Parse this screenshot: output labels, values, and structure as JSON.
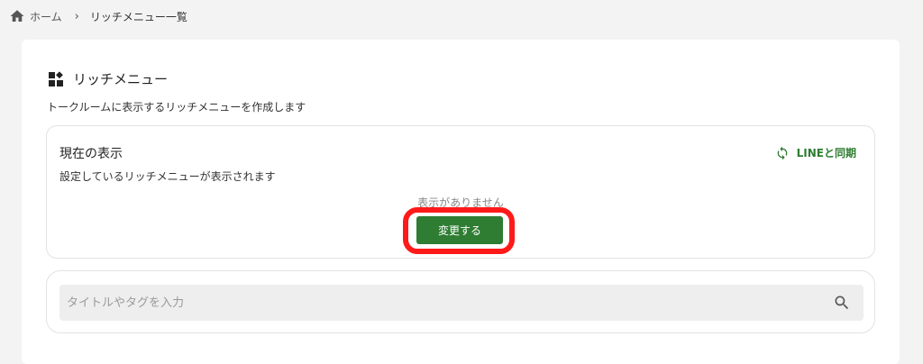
{
  "breadcrumb": {
    "home_label": "ホーム",
    "separator": "›",
    "current": "リッチメニュー一覧"
  },
  "section": {
    "title": "リッチメニュー",
    "description": "トークルームに表示するリッチメニューを作成します"
  },
  "current_display": {
    "title": "現在の表示",
    "description": "設定しているリッチメニューが表示されます",
    "sync_label": "LINEと同期",
    "empty_text": "表示がありません",
    "change_button": "変更する"
  },
  "search": {
    "placeholder": "タイトルやタグを入力",
    "value": ""
  },
  "icons": {
    "home": "home-icon",
    "widgets": "widgets-icon",
    "sync": "sync-icon",
    "search": "search-icon"
  },
  "colors": {
    "accent_green": "#2e7d32",
    "highlight_red": "#ff1a1a",
    "page_bg": "#f3f3f3"
  }
}
